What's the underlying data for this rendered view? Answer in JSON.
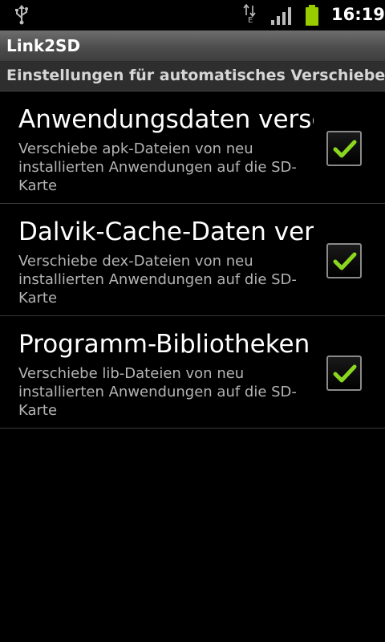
{
  "status_bar": {
    "time": "16:19",
    "network_type": "E",
    "battery_color": "#99cc00",
    "icons": [
      "usb-icon",
      "data-activity-icon",
      "signal-icon",
      "battery-icon"
    ]
  },
  "app": {
    "title": "Link2SD"
  },
  "category": {
    "title": "Einstellungen für automatisches Verschieben"
  },
  "preferences": [
    {
      "title": "Anwendungsdaten verschieben",
      "summary": "Verschiebe apk-Dateien von neu installierten Anwendungen auf die SD-Karte",
      "checked": true
    },
    {
      "title": "Dalvik-Cache-Daten verschieben",
      "summary": "Verschiebe dex-Dateien von neu installierten Anwendungen auf die SD-Karte",
      "checked": true
    },
    {
      "title": "Programm-Bibliotheken verschieben",
      "summary": "Verschiebe lib-Dateien von neu installierten Anwendungen auf die SD-Karte",
      "checked": true
    }
  ],
  "colors": {
    "checkmark": "#8bd61e",
    "background": "#000000"
  }
}
